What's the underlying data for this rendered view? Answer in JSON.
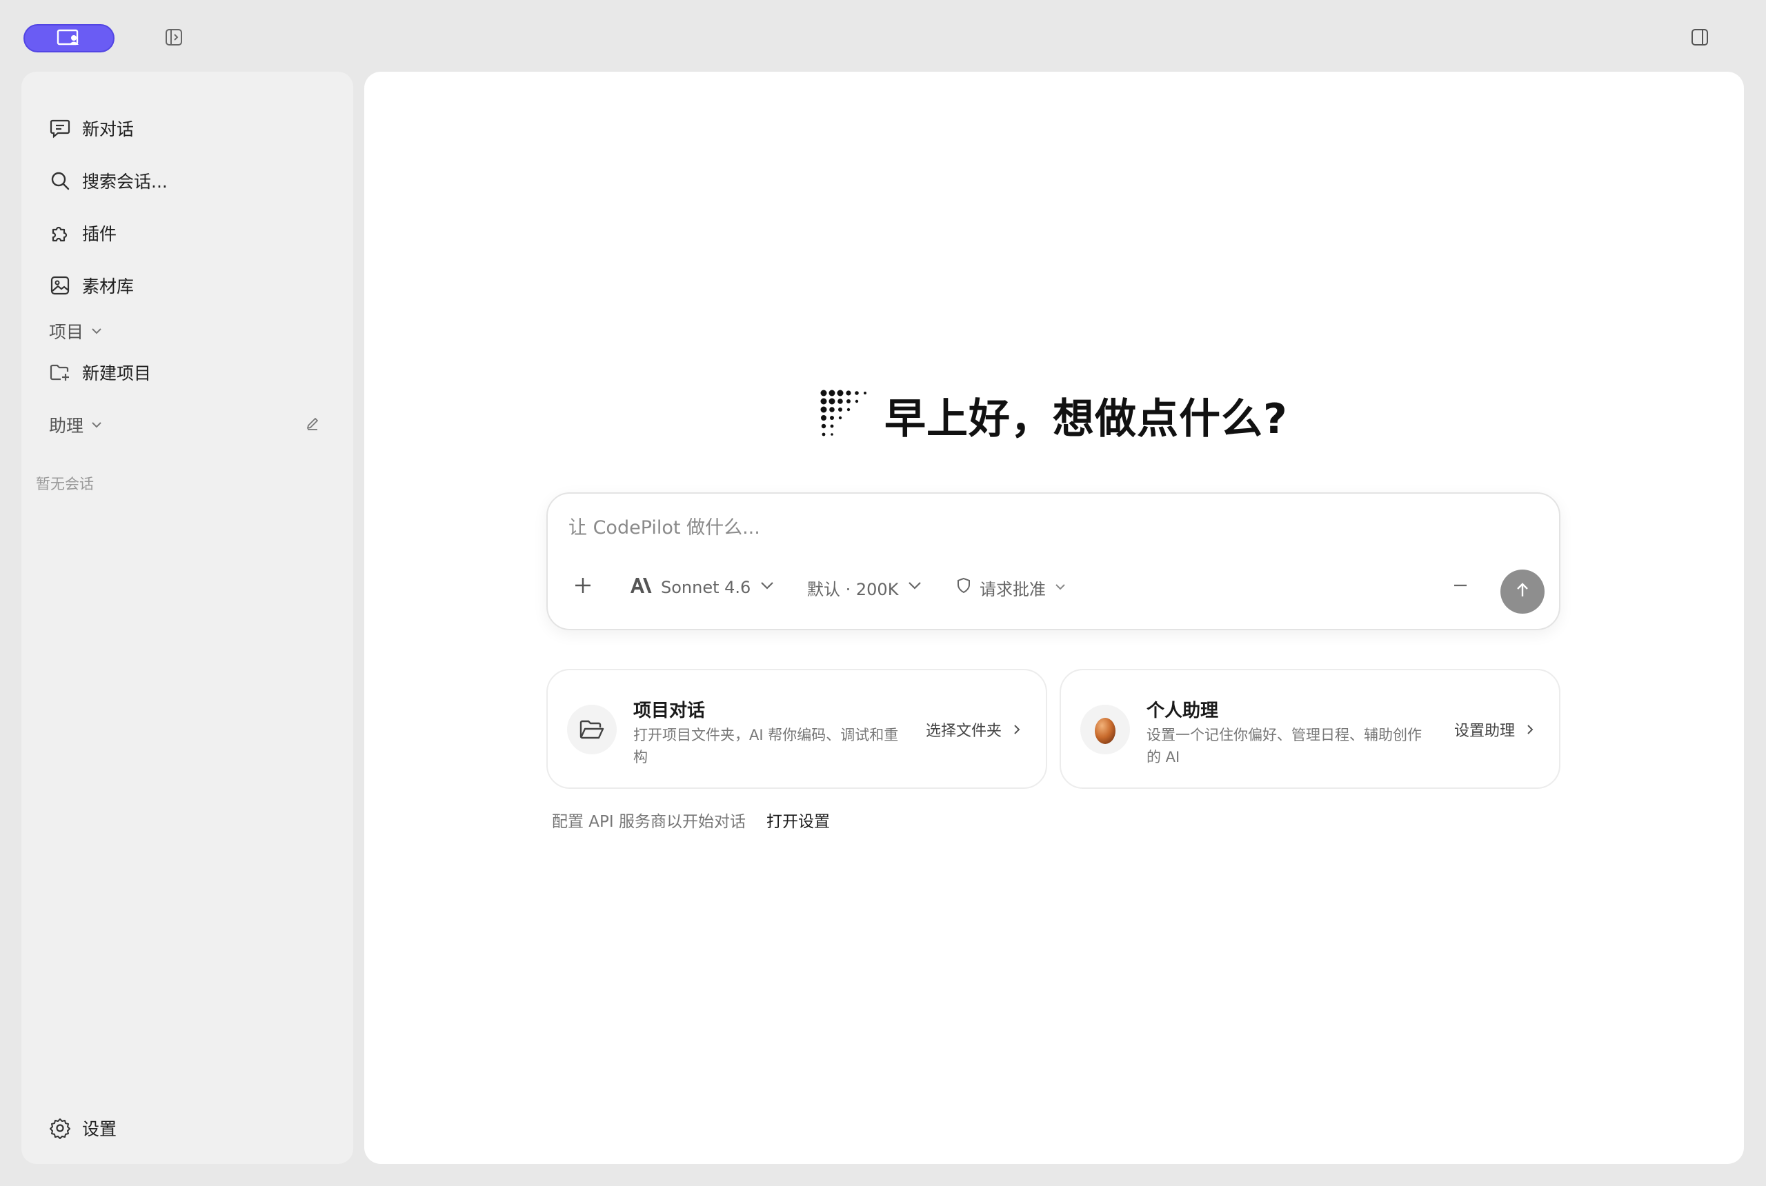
{
  "toolbar": {
    "app_switch_icon": "profile-screen-icon",
    "sidebar_toggle_icon": "panel-left-icon",
    "right_panel_icon": "panel-right-icon",
    "accent": "#6a5cf4"
  },
  "sidebar": {
    "new_chat": "新对话",
    "search": "搜索会话...",
    "plugins": "插件",
    "library": "素材库",
    "projects_label": "项目",
    "new_project": "新建项目",
    "assistant_label": "助理",
    "empty": "暂无会话",
    "settings": "设置"
  },
  "main": {
    "greeting": "早上好，想做点什么?",
    "composer": {
      "placeholder": "让 CodePilot 做什么...",
      "value": "",
      "model": "Sonnet 4.6",
      "context": "默认 · 200K",
      "permission": "请求批准"
    },
    "cards": [
      {
        "title": "项目对话",
        "desc": "打开项目文件夹，AI 帮你编码、调试和重构",
        "action": "选择文件夹"
      },
      {
        "title": "个人助理",
        "desc": "设置一个记住你偏好、管理日程、辅助创作的 AI",
        "action": "设置助理"
      }
    ],
    "hint": "配置 API 服务商以开始对话",
    "hint_link": "打开设置"
  }
}
